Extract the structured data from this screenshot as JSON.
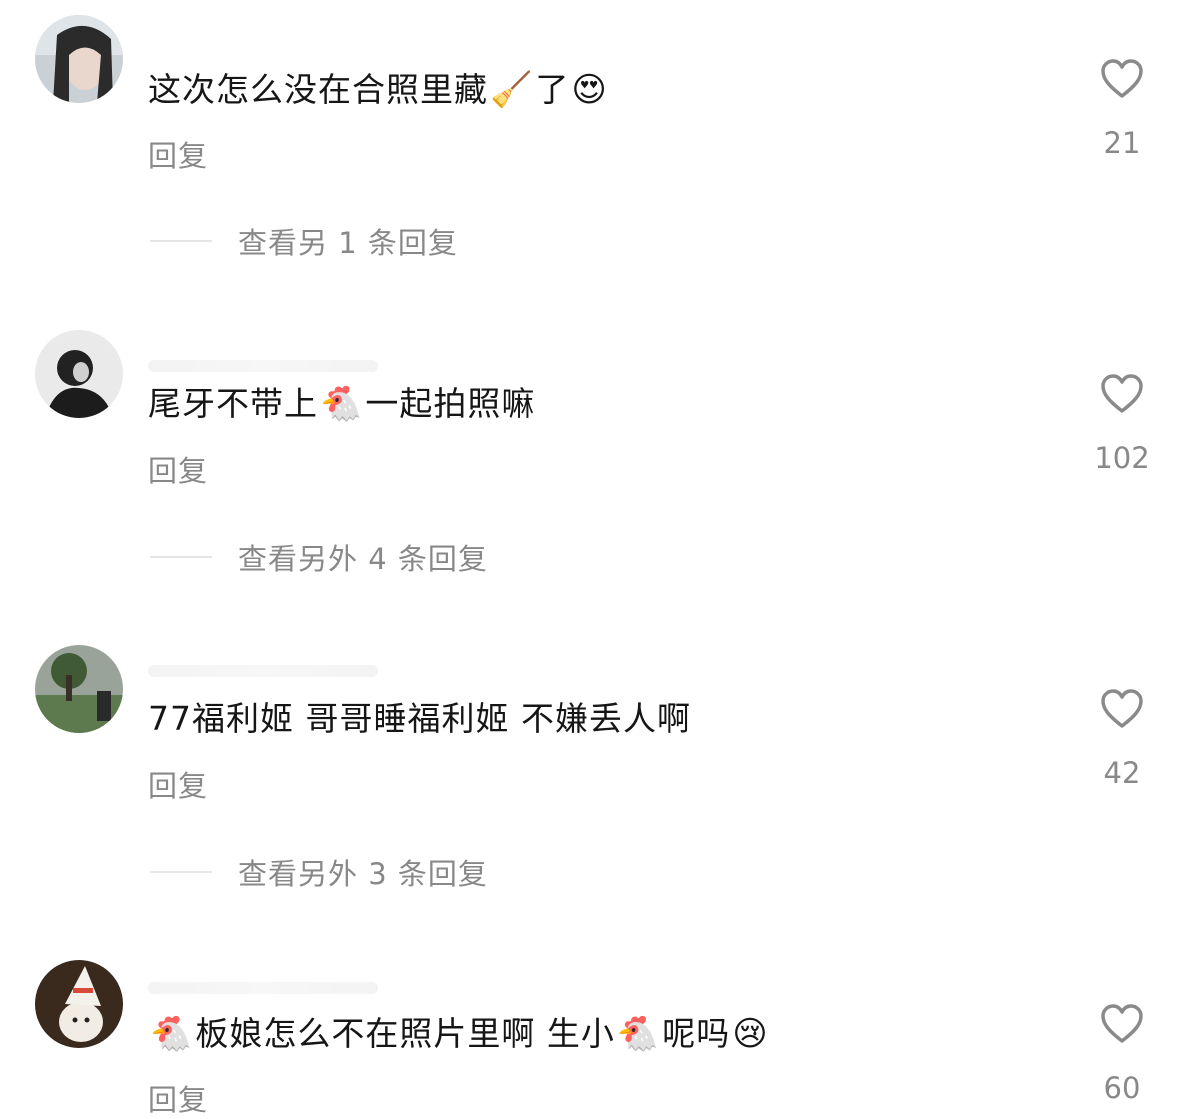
{
  "comments": [
    {
      "text": "这次怎么没在合照里藏",
      "emoji_inline": "🧹",
      "text_after": "了",
      "emoji_end": "😍",
      "reply": "回复",
      "likes": "21",
      "more_replies": "查看另 1 条回复"
    },
    {
      "text": "尾牙不带上",
      "emoji_inline": "🐔",
      "text_after": "一起拍照嘛",
      "reply": "回复",
      "likes": "102",
      "more_replies": "查看另外 4 条回复"
    },
    {
      "text": "77福利姬 哥哥睡福利姬 不嫌丢人啊",
      "reply": "回复",
      "likes": "42",
      "more_replies": "查看另外 3 条回复"
    },
    {
      "emoji_start": "🐔",
      "text": "板娘怎么不在照片里啊 生小",
      "emoji_inline": "🐔",
      "text_after": "呢吗",
      "emoji_end": "😢",
      "reply": "回复",
      "likes": "60"
    }
  ],
  "icons": {
    "like": "heart-outline-icon"
  }
}
